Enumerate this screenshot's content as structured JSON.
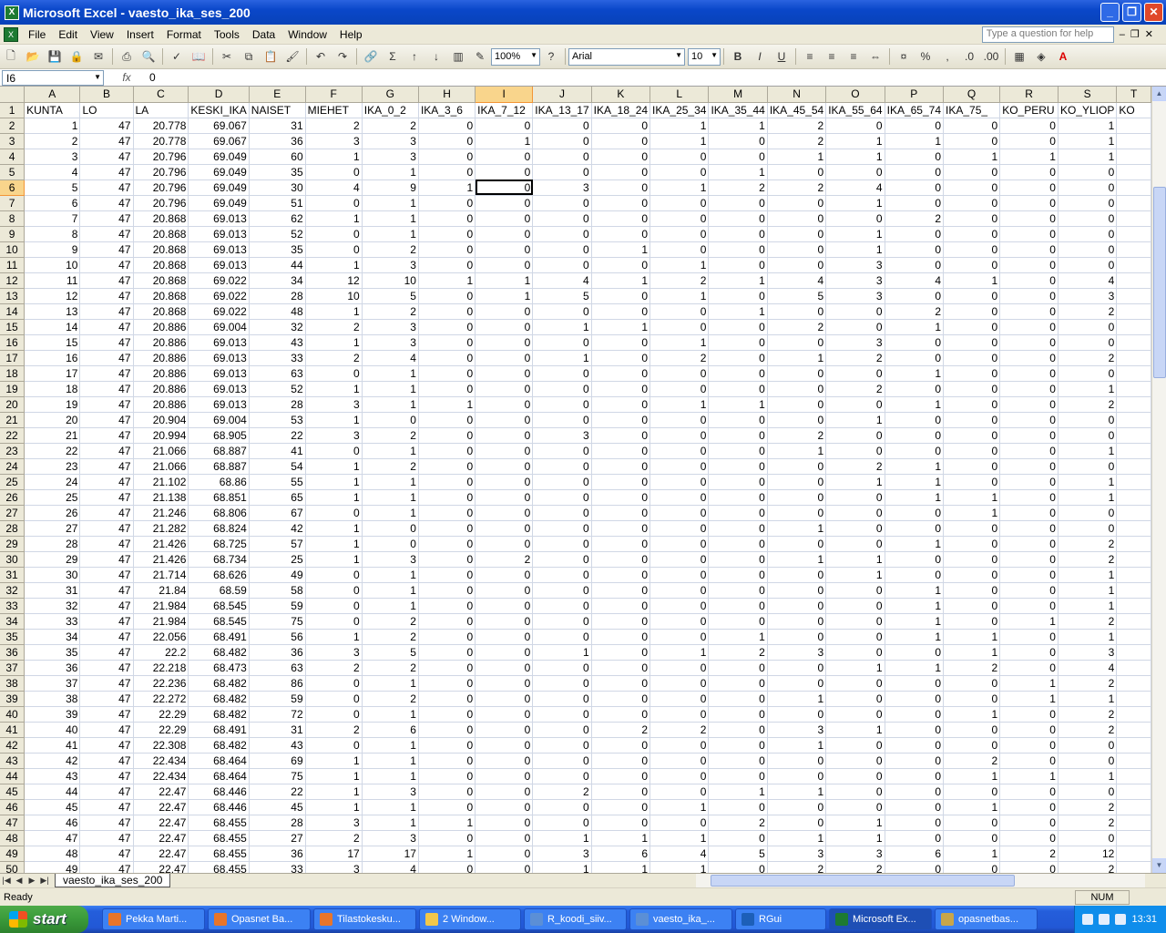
{
  "window": {
    "title": "Microsoft Excel - vaesto_ika_ses_200"
  },
  "menu": {
    "items": [
      "File",
      "Edit",
      "View",
      "Insert",
      "Format",
      "Tools",
      "Data",
      "Window",
      "Help"
    ],
    "help_placeholder": "Type a question for help"
  },
  "toolbar": {
    "zoom": "100%",
    "font": "Arial",
    "size": "10"
  },
  "formula": {
    "cell": "I6",
    "fx": "fx",
    "value": "0"
  },
  "columns": [
    "A",
    "B",
    "C",
    "D",
    "E",
    "F",
    "G",
    "H",
    "I",
    "J",
    "K",
    "L",
    "M",
    "N",
    "O",
    "P",
    "Q",
    "R",
    "S",
    "T"
  ],
  "selected_col": "I",
  "selected_row": 6,
  "headers": [
    "KUNTA",
    "LO",
    "LA",
    "KESKI_IKA",
    "NAISET",
    "MIEHET",
    "IKA_0_2",
    "IKA_3_6",
    "IKA_7_12",
    "IKA_13_17",
    "IKA_18_24",
    "IKA_25_34",
    "IKA_35_44",
    "IKA_45_54",
    "IKA_55_64",
    "IKA_65_74",
    "IKA_75_",
    "KO_PERU",
    "KO_YLIOP",
    "KO"
  ],
  "rows": [
    [
      1,
      47,
      "20.778",
      "69.067",
      31,
      2,
      2,
      0,
      0,
      0,
      0,
      1,
      1,
      2,
      0,
      0,
      0,
      0,
      1
    ],
    [
      2,
      47,
      "20.778",
      "69.067",
      36,
      3,
      3,
      0,
      1,
      0,
      0,
      1,
      0,
      2,
      1,
      1,
      0,
      0,
      1
    ],
    [
      3,
      47,
      "20.796",
      "69.049",
      60,
      1,
      3,
      0,
      0,
      0,
      0,
      0,
      0,
      1,
      1,
      0,
      1,
      1,
      1
    ],
    [
      4,
      47,
      "20.796",
      "69.049",
      35,
      0,
      1,
      0,
      0,
      0,
      0,
      0,
      1,
      0,
      0,
      0,
      0,
      0,
      0
    ],
    [
      5,
      47,
      "20.796",
      "69.049",
      30,
      4,
      9,
      1,
      0,
      3,
      0,
      1,
      2,
      2,
      4,
      0,
      0,
      0,
      0
    ],
    [
      6,
      47,
      "20.796",
      "69.049",
      51,
      0,
      1,
      0,
      0,
      0,
      0,
      0,
      0,
      0,
      1,
      0,
      0,
      0,
      0
    ],
    [
      7,
      47,
      "20.868",
      "69.013",
      62,
      1,
      1,
      0,
      0,
      0,
      0,
      0,
      0,
      0,
      0,
      2,
      0,
      0,
      0
    ],
    [
      8,
      47,
      "20.868",
      "69.013",
      52,
      0,
      1,
      0,
      0,
      0,
      0,
      0,
      0,
      0,
      1,
      0,
      0,
      0,
      0
    ],
    [
      9,
      47,
      "20.868",
      "69.013",
      35,
      0,
      2,
      0,
      0,
      0,
      1,
      0,
      0,
      0,
      1,
      0,
      0,
      0,
      0
    ],
    [
      10,
      47,
      "20.868",
      "69.013",
      44,
      1,
      3,
      0,
      0,
      0,
      0,
      1,
      0,
      0,
      3,
      0,
      0,
      0,
      0
    ],
    [
      11,
      47,
      "20.868",
      "69.022",
      34,
      12,
      10,
      1,
      1,
      4,
      1,
      2,
      1,
      4,
      3,
      4,
      1,
      0,
      4
    ],
    [
      12,
      47,
      "20.868",
      "69.022",
      28,
      10,
      5,
      0,
      1,
      5,
      0,
      1,
      0,
      5,
      3,
      0,
      0,
      0,
      3
    ],
    [
      13,
      47,
      "20.868",
      "69.022",
      48,
      1,
      2,
      0,
      0,
      0,
      0,
      0,
      1,
      0,
      0,
      2,
      0,
      0,
      2
    ],
    [
      14,
      47,
      "20.886",
      "69.004",
      32,
      2,
      3,
      0,
      0,
      1,
      1,
      0,
      0,
      2,
      0,
      1,
      0,
      0,
      0
    ],
    [
      15,
      47,
      "20.886",
      "69.013",
      43,
      1,
      3,
      0,
      0,
      0,
      0,
      1,
      0,
      0,
      3,
      0,
      0,
      0,
      0
    ],
    [
      16,
      47,
      "20.886",
      "69.013",
      33,
      2,
      4,
      0,
      0,
      1,
      0,
      2,
      0,
      1,
      2,
      0,
      0,
      0,
      2
    ],
    [
      17,
      47,
      "20.886",
      "69.013",
      63,
      0,
      1,
      0,
      0,
      0,
      0,
      0,
      0,
      0,
      0,
      1,
      0,
      0,
      0
    ],
    [
      18,
      47,
      "20.886",
      "69.013",
      52,
      1,
      1,
      0,
      0,
      0,
      0,
      0,
      0,
      0,
      2,
      0,
      0,
      0,
      1
    ],
    [
      19,
      47,
      "20.886",
      "69.013",
      28,
      3,
      1,
      1,
      0,
      0,
      0,
      1,
      1,
      0,
      0,
      1,
      0,
      0,
      2
    ],
    [
      20,
      47,
      "20.904",
      "69.004",
      53,
      1,
      0,
      0,
      0,
      0,
      0,
      0,
      0,
      0,
      1,
      0,
      0,
      0,
      0
    ],
    [
      21,
      47,
      "20.994",
      "68.905",
      22,
      3,
      2,
      0,
      0,
      3,
      0,
      0,
      0,
      2,
      0,
      0,
      0,
      0,
      0
    ],
    [
      22,
      47,
      "21.066",
      "68.887",
      41,
      0,
      1,
      0,
      0,
      0,
      0,
      0,
      0,
      1,
      0,
      0,
      0,
      0,
      1
    ],
    [
      23,
      47,
      "21.066",
      "68.887",
      54,
      1,
      2,
      0,
      0,
      0,
      0,
      0,
      0,
      0,
      2,
      1,
      0,
      0,
      0
    ],
    [
      24,
      47,
      "21.102",
      "68.86",
      55,
      1,
      1,
      0,
      0,
      0,
      0,
      0,
      0,
      0,
      1,
      1,
      0,
      0,
      1
    ],
    [
      25,
      47,
      "21.138",
      "68.851",
      65,
      1,
      1,
      0,
      0,
      0,
      0,
      0,
      0,
      0,
      0,
      1,
      1,
      0,
      1
    ],
    [
      26,
      47,
      "21.246",
      "68.806",
      67,
      0,
      1,
      0,
      0,
      0,
      0,
      0,
      0,
      0,
      0,
      0,
      1,
      0,
      0
    ],
    [
      27,
      47,
      "21.282",
      "68.824",
      42,
      1,
      0,
      0,
      0,
      0,
      0,
      0,
      0,
      1,
      0,
      0,
      0,
      0,
      0
    ],
    [
      28,
      47,
      "21.426",
      "68.725",
      57,
      1,
      0,
      0,
      0,
      0,
      0,
      0,
      0,
      0,
      0,
      1,
      0,
      0,
      2
    ],
    [
      29,
      47,
      "21.426",
      "68.734",
      25,
      1,
      3,
      0,
      2,
      0,
      0,
      0,
      0,
      1,
      1,
      0,
      0,
      0,
      2
    ],
    [
      30,
      47,
      "21.714",
      "68.626",
      49,
      0,
      1,
      0,
      0,
      0,
      0,
      0,
      0,
      0,
      1,
      0,
      0,
      0,
      1
    ],
    [
      31,
      47,
      "21.84",
      "68.59",
      58,
      0,
      1,
      0,
      0,
      0,
      0,
      0,
      0,
      0,
      0,
      1,
      0,
      0,
      1
    ],
    [
      32,
      47,
      "21.984",
      "68.545",
      59,
      0,
      1,
      0,
      0,
      0,
      0,
      0,
      0,
      0,
      0,
      1,
      0,
      0,
      1
    ],
    [
      33,
      47,
      "21.984",
      "68.545",
      75,
      0,
      2,
      0,
      0,
      0,
      0,
      0,
      0,
      0,
      0,
      1,
      0,
      1,
      2
    ],
    [
      34,
      47,
      "22.056",
      "68.491",
      56,
      1,
      2,
      0,
      0,
      0,
      0,
      0,
      1,
      0,
      0,
      1,
      1,
      0,
      1
    ],
    [
      35,
      47,
      "22.2",
      "68.482",
      36,
      3,
      5,
      0,
      0,
      1,
      0,
      1,
      2,
      3,
      0,
      0,
      1,
      0,
      3
    ],
    [
      36,
      47,
      "22.218",
      "68.473",
      63,
      2,
      2,
      0,
      0,
      0,
      0,
      0,
      0,
      0,
      1,
      1,
      2,
      0,
      4
    ],
    [
      37,
      47,
      "22.236",
      "68.482",
      86,
      0,
      1,
      0,
      0,
      0,
      0,
      0,
      0,
      0,
      0,
      0,
      0,
      1,
      2
    ],
    [
      38,
      47,
      "22.272",
      "68.482",
      59,
      0,
      2,
      0,
      0,
      0,
      0,
      0,
      0,
      1,
      0,
      0,
      0,
      1,
      1
    ],
    [
      39,
      47,
      "22.29",
      "68.482",
      72,
      0,
      1,
      0,
      0,
      0,
      0,
      0,
      0,
      0,
      0,
      0,
      1,
      0,
      2
    ],
    [
      40,
      47,
      "22.29",
      "68.491",
      31,
      2,
      6,
      0,
      0,
      0,
      2,
      2,
      0,
      3,
      1,
      0,
      0,
      0,
      2
    ],
    [
      41,
      47,
      "22.308",
      "68.482",
      43,
      0,
      1,
      0,
      0,
      0,
      0,
      0,
      0,
      1,
      0,
      0,
      0,
      0,
      0
    ],
    [
      42,
      47,
      "22.434",
      "68.464",
      69,
      1,
      1,
      0,
      0,
      0,
      0,
      0,
      0,
      0,
      0,
      0,
      2,
      0,
      0
    ],
    [
      43,
      47,
      "22.434",
      "68.464",
      75,
      1,
      1,
      0,
      0,
      0,
      0,
      0,
      0,
      0,
      0,
      0,
      1,
      1,
      1
    ],
    [
      44,
      47,
      "22.47",
      "68.446",
      22,
      1,
      3,
      0,
      0,
      2,
      0,
      0,
      1,
      1,
      0,
      0,
      0,
      0,
      0
    ],
    [
      45,
      47,
      "22.47",
      "68.446",
      45,
      1,
      1,
      0,
      0,
      0,
      0,
      1,
      0,
      0,
      0,
      0,
      1,
      0,
      2
    ],
    [
      46,
      47,
      "22.47",
      "68.455",
      28,
      3,
      1,
      1,
      0,
      0,
      0,
      0,
      2,
      0,
      1,
      0,
      0,
      0,
      2
    ],
    [
      47,
      47,
      "22.47",
      "68.455",
      27,
      2,
      3,
      0,
      0,
      1,
      1,
      1,
      0,
      1,
      1,
      0,
      0,
      0,
      0
    ],
    [
      48,
      47,
      "22.47",
      "68.455",
      36,
      17,
      17,
      1,
      0,
      3,
      6,
      4,
      5,
      3,
      3,
      6,
      1,
      2,
      12
    ],
    [
      49,
      47,
      "22.47",
      "68.455",
      33,
      3,
      4,
      0,
      0,
      1,
      1,
      1,
      0,
      2,
      2,
      0,
      0,
      0,
      2
    ]
  ],
  "sheet": {
    "tab": "vaesto_ika_ses_200"
  },
  "status": {
    "left": "Ready",
    "num": "NUM"
  },
  "taskbar": {
    "start": "start",
    "tasks": [
      "Pekka Marti...",
      "Opasnet Ba...",
      "Tilastokesku...",
      "2 Window...",
      "R_koodi_siiv...",
      "vaesto_ika_...",
      "RGui",
      "Microsoft Ex...",
      "opasnetbas..."
    ],
    "task_colors": [
      "#e8752a",
      "#e8752a",
      "#e8752a",
      "#f2c84b",
      "#5b8fd6",
      "#5b8fd6",
      "#1d5fb8",
      "#1d7a32",
      "#c9a64a"
    ],
    "active_task": 7,
    "time": "13:31"
  }
}
